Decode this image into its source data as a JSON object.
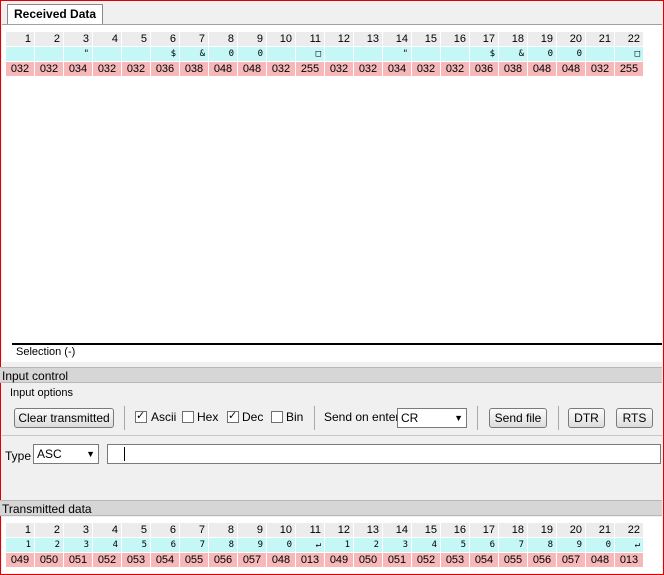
{
  "tab": {
    "label": "Received Data"
  },
  "received": {
    "headers": [
      "1",
      "2",
      "3",
      "4",
      "5",
      "6",
      "7",
      "8",
      "9",
      "10",
      "11",
      "12",
      "13",
      "14",
      "15",
      "16",
      "17",
      "18",
      "19",
      "20",
      "21",
      "22"
    ],
    "ascii": [
      " ",
      " ",
      "\"",
      " ",
      " ",
      "$",
      "&",
      "0",
      "0",
      " ",
      "□",
      " ",
      " ",
      "\"",
      " ",
      " ",
      "$",
      "&",
      "0",
      "0",
      " ",
      "□"
    ],
    "dec": [
      "032",
      "032",
      "034",
      "032",
      "032",
      "036",
      "038",
      "048",
      "048",
      "032",
      "255",
      "032",
      "032",
      "034",
      "032",
      "032",
      "036",
      "038",
      "048",
      "048",
      "032",
      "255"
    ]
  },
  "selection": {
    "label": "Selection (-)"
  },
  "input_control": {
    "header": "Input control",
    "options_label": "Input options",
    "clear_button": "Clear transmitted",
    "ascii_label": "Ascii",
    "hex_label": "Hex",
    "dec_label": "Dec",
    "bin_label": "Bin",
    "send_on_enter_label": "Send on enter",
    "send_on_enter_value": "CR",
    "send_file_button": "Send file",
    "dtr_button": "DTR",
    "rts_button": "RTS",
    "type_label": "Type",
    "type_value": "ASC",
    "input_value": ""
  },
  "transmitted": {
    "header": "Transmitted data",
    "headers": [
      "1",
      "2",
      "3",
      "4",
      "5",
      "6",
      "7",
      "8",
      "9",
      "10",
      "11",
      "12",
      "13",
      "14",
      "15",
      "16",
      "17",
      "18",
      "19",
      "20",
      "21",
      "22"
    ],
    "ascii": [
      "1",
      "2",
      "3",
      "4",
      "5",
      "6",
      "7",
      "8",
      "9",
      "0",
      "↵",
      "1",
      "2",
      "3",
      "4",
      "5",
      "6",
      "7",
      "8",
      "9",
      "0",
      "↵"
    ],
    "dec": [
      "049",
      "050",
      "051",
      "052",
      "053",
      "054",
      "055",
      "056",
      "057",
      "048",
      "013",
      "049",
      "050",
      "051",
      "052",
      "053",
      "054",
      "055",
      "056",
      "057",
      "048",
      "013"
    ]
  }
}
